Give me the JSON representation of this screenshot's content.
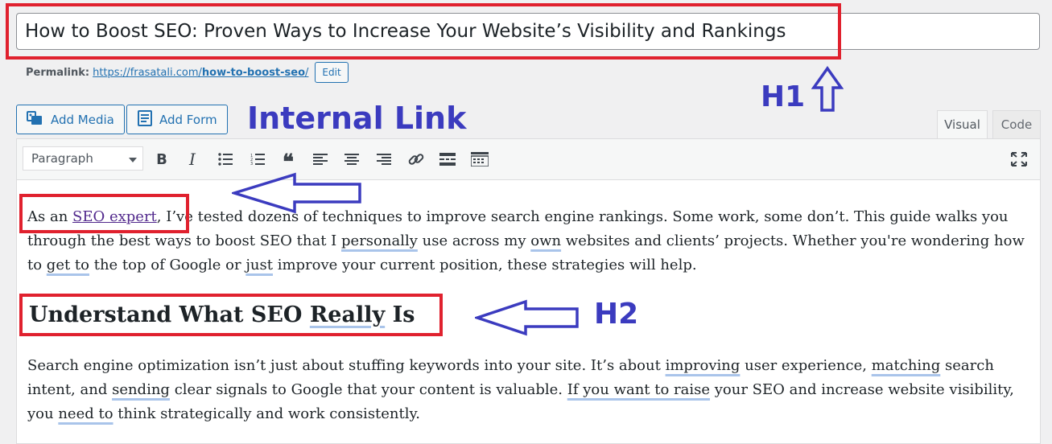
{
  "post": {
    "title": "How to Boost SEO: Proven Ways to Increase Your Website’s Visibility and Rankings",
    "permalink_label": "Permalink:",
    "permalink_base": "https://frasatali.com/",
    "permalink_slug": "how-to-boost-seo",
    "permalink_end": "/",
    "edit_label": "Edit"
  },
  "media_bar": {
    "add_media": "Add Media",
    "add_form": "Add Form"
  },
  "tabs": {
    "visual": "Visual",
    "code": "Code"
  },
  "toolbar": {
    "format": "Paragraph",
    "buttons": [
      "bold",
      "italic",
      "bulleted-list",
      "numbered-list",
      "blockquote",
      "align-left",
      "align-center",
      "align-right",
      "insert-link",
      "read-more",
      "toolbar-toggle",
      "fullscreen"
    ]
  },
  "content": {
    "p1_a": "As an ",
    "p1_link": "SEO expert",
    "p1_b": ", I’ve tested dozens of techniques to improve search engine rankings. Some work, some don’t. This guide walks you through the best ways to boost SEO that I ",
    "p1_w1": "personally",
    "p1_c": " use across my ",
    "p1_w2": "own",
    "p1_d": " websites and clients’ projects. Whether you're wondering how to ",
    "p1_w3": "get to",
    "p1_e": " the top of Google or ",
    "p1_w4": "just",
    "p1_f": " improve your current position, these strategies will help.",
    "h2_a": "Understand What SEO ",
    "h2_w": "Really",
    "h2_b": " Is",
    "p2_a": "Search engine optimization isn’t just about stuffing keywords into your site. It’s about ",
    "p2_w1": "improving",
    "p2_b": " user experience, ",
    "p2_w2": "matching",
    "p2_c": " search intent, and ",
    "p2_w3": "sending",
    "p2_d": " clear signals to Google that your content is valuable. ",
    "p2_w4": "If you want to raise",
    "p2_e": " your SEO and increase website visibility, you ",
    "p2_w5": "need to",
    "p2_f": " think strategically and work consistently."
  },
  "annotations": {
    "h1": "H1",
    "internal_link": "Internal Link",
    "h2": "H2"
  },
  "colors": {
    "highlight": "#e0212e",
    "annotation": "#3b3bbf",
    "wp_blue": "#2271b1",
    "link": "#51288c",
    "spellcheck": "#a9c4ea"
  }
}
